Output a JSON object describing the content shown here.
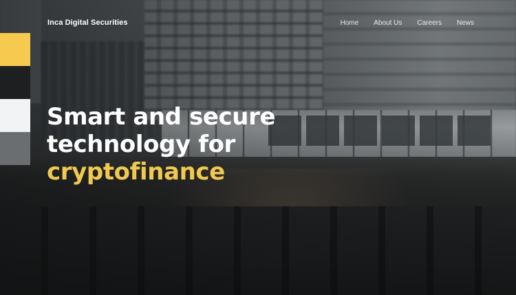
{
  "brand": {
    "name": "Inca Digital Securities"
  },
  "nav": {
    "items": [
      {
        "label": "Home"
      },
      {
        "label": "About Us"
      },
      {
        "label": "Careers"
      },
      {
        "label": "News"
      }
    ]
  },
  "hero": {
    "headline_line1": "Smart and secure",
    "headline_line2": "technology for",
    "headline_accent": "cryptofinance"
  },
  "swatches": [
    "#f6ca4f",
    "#1d1f20",
    "#f2f3f4",
    "#6a6e70"
  ],
  "colors": {
    "accent": "#f0c94e",
    "text": "#ffffff"
  }
}
